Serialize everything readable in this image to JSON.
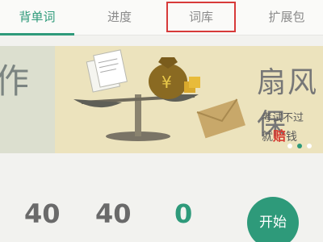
{
  "tabs": [
    {
      "label": "背单词",
      "active": true
    },
    {
      "label": "进度",
      "active": false
    },
    {
      "label": "词库",
      "active": false
    },
    {
      "label": "扩展包",
      "active": false
    }
  ],
  "banner": {
    "left_text": "作",
    "title": "扇风保",
    "line1": "考试不过",
    "line2_prefix": "就",
    "line2_highlight": "赔",
    "line2_suffix": "钱",
    "money_symbol": "¥",
    "slide_count": 3,
    "active_slide": 2
  },
  "stats": {
    "value1": "40",
    "value2": "40",
    "value3": "0"
  },
  "start_label": "开始",
  "colors": {
    "accent": "#2e9a7a",
    "highlight_box": "#d73a3a",
    "banner_bg": "#ece3bd"
  }
}
